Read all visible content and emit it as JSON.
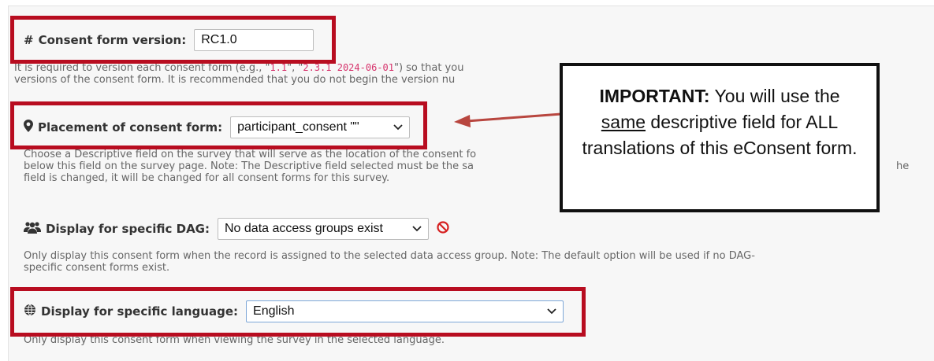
{
  "version": {
    "label": "Consent form version:",
    "value": "RC1.0",
    "desc_prefix": "It is required to version each consent form (e.g., \"",
    "example1": "1.1",
    "desc_mid": "\", \"",
    "example2": "2.3.1 2024-06-01",
    "desc_suffix": "\") so that you",
    "desc_line2": "versions of the consent form. It is recommended that you do not begin the version nu"
  },
  "placement": {
    "label": "Placement of consent form:",
    "value": "participant_consent \"\"",
    "desc_line1": "Choose a Descriptive field on the survey that will serve as the location of the consent fo",
    "desc_line2": "below this field on the survey page. Note: The Descriptive field selected must be the sa",
    "desc_line2_tail": "he",
    "desc_line3": "field is changed, it will be changed for all consent forms for this survey."
  },
  "dag": {
    "label": "Display for specific DAG:",
    "value": "No data access groups exist",
    "desc_line1": "Only display this consent form when the record is assigned to the selected data access group. Note: The default option will be used if no DAG-",
    "desc_line2": "specific consent forms exist."
  },
  "language": {
    "label": "Display for specific language:",
    "value": "English",
    "desc": "Only display this consent form when viewing the survey in the selected language."
  },
  "callout": {
    "strong": "IMPORTANT:",
    "text1": " You will use the ",
    "underlined": "same",
    "text2": " descriptive field for ALL translations of this eConsent form."
  },
  "colors": {
    "highlight": "#b80d20",
    "arrow": "#b8463f",
    "forbidden": "#d62020"
  }
}
